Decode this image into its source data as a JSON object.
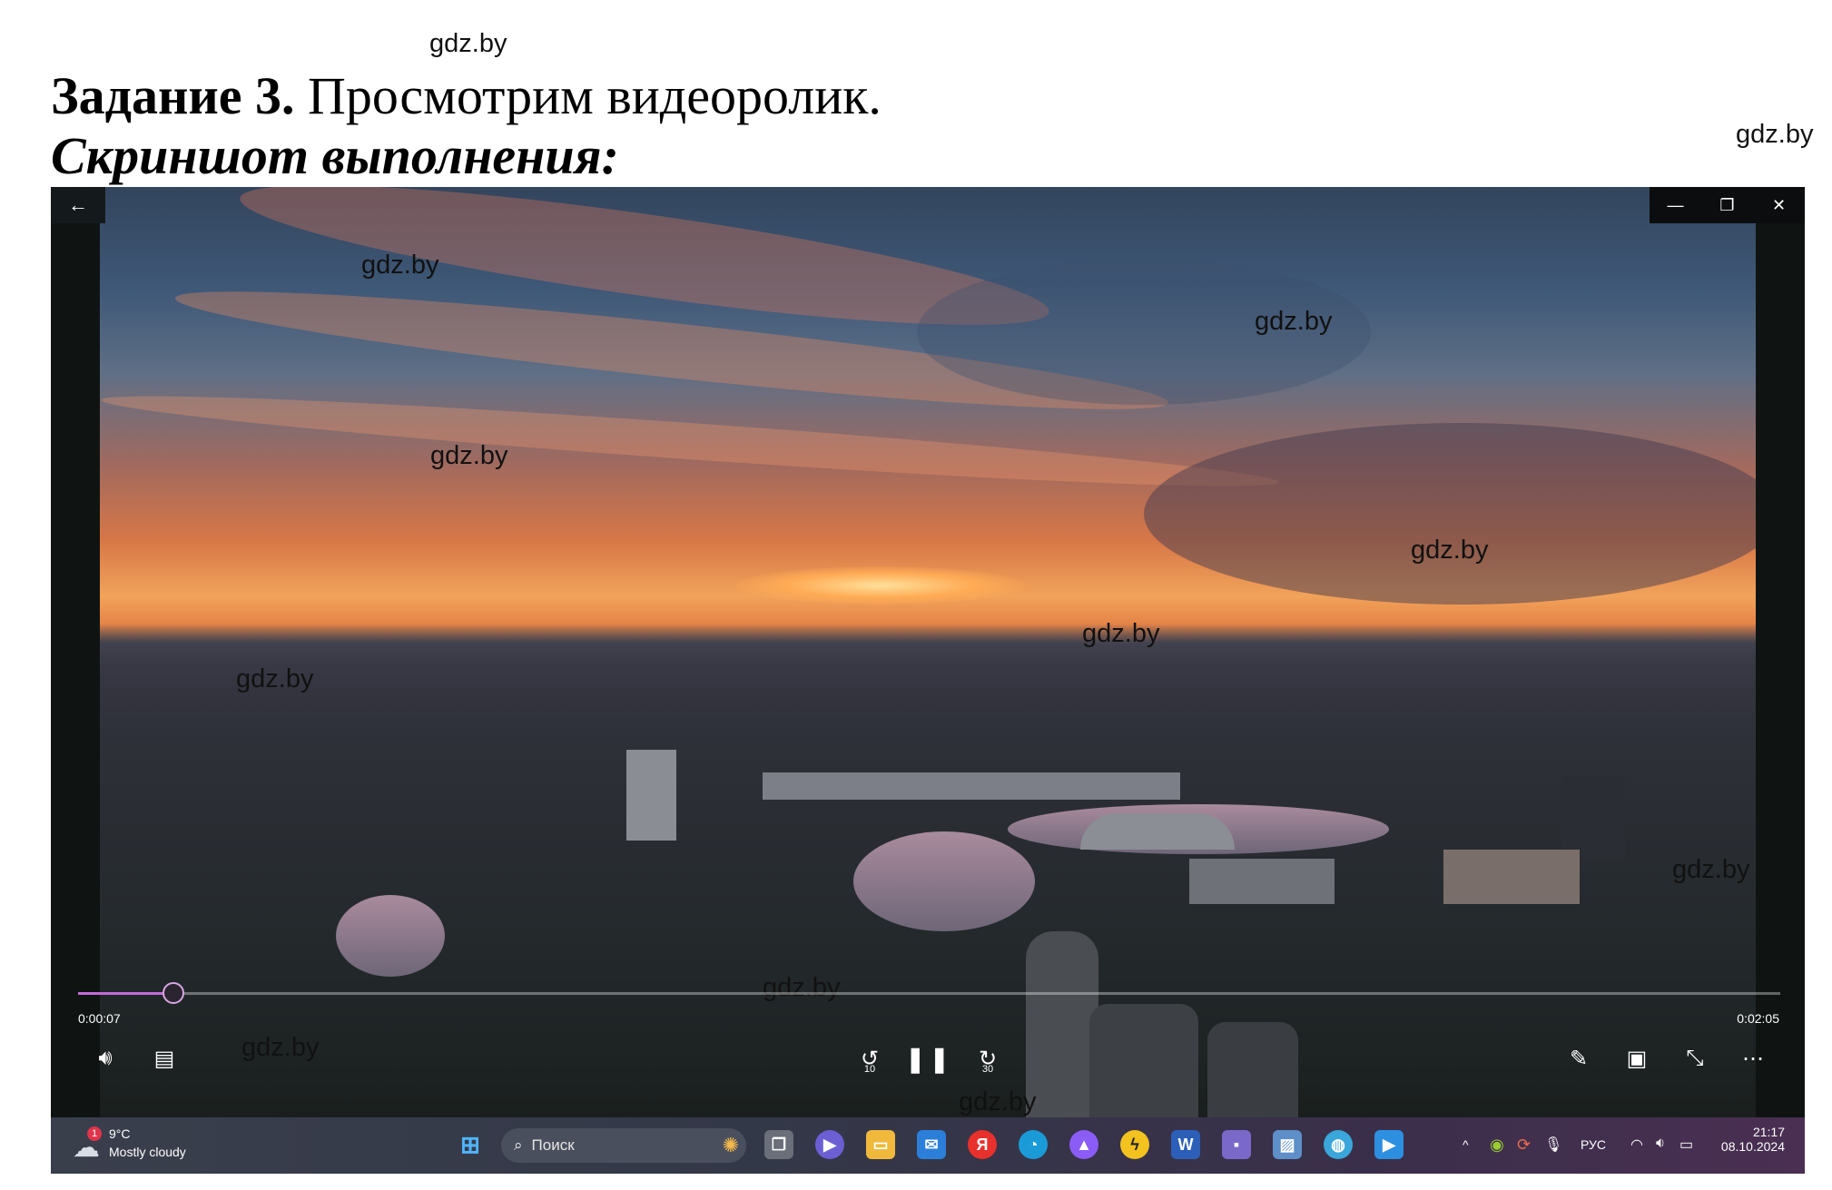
{
  "watermark": "gdz.by",
  "heading": {
    "bold": "Задание 3.",
    "rest": " Просмотрим видеоролик."
  },
  "subtitle": "Скриншот выполнения:",
  "player": {
    "elapsed": "0:00:07",
    "total": "0:02:05",
    "progress_fraction": 0.056,
    "skip_back_label": "10",
    "skip_forward_label": "30"
  },
  "taskbar": {
    "weather_badge": "1",
    "temperature": "9°C",
    "weather_text": "Mostly cloudy",
    "search_placeholder": "Поиск",
    "language": "РУС",
    "time": "21:17",
    "date": "08.10.2024"
  },
  "icons": {
    "yandex_letter": "Я",
    "word_letter": "W"
  },
  "colors": {
    "progress_accent": "#c36bd6"
  }
}
